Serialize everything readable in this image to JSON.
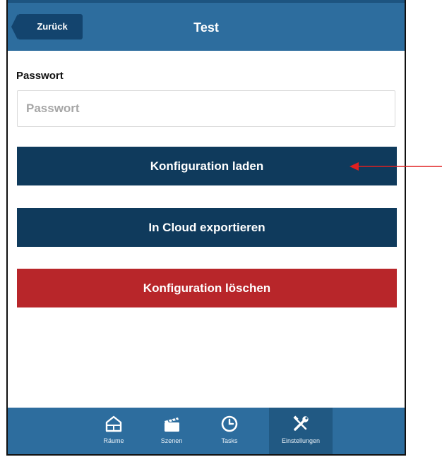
{
  "header": {
    "back_label": "Zurück",
    "title": "Test"
  },
  "password": {
    "label": "Passwort",
    "placeholder": "Passwort",
    "value": ""
  },
  "actions": {
    "load_label": "Konfiguration laden",
    "export_label": "In Cloud exportieren",
    "delete_label": "Konfiguration löschen"
  },
  "tabbar": {
    "items": [
      {
        "label": "Räume",
        "icon": "rooms-icon"
      },
      {
        "label": "Szenen",
        "icon": "scenes-icon"
      },
      {
        "label": "Tasks",
        "icon": "clock-icon"
      },
      {
        "label": "Einstellungen",
        "icon": "tools-icon",
        "active": true
      }
    ]
  },
  "colors": {
    "header": "#2d6d9e",
    "primary_button": "#0f3a5c",
    "danger_button": "#b8262a",
    "annotation_arrow": "#e02020"
  }
}
